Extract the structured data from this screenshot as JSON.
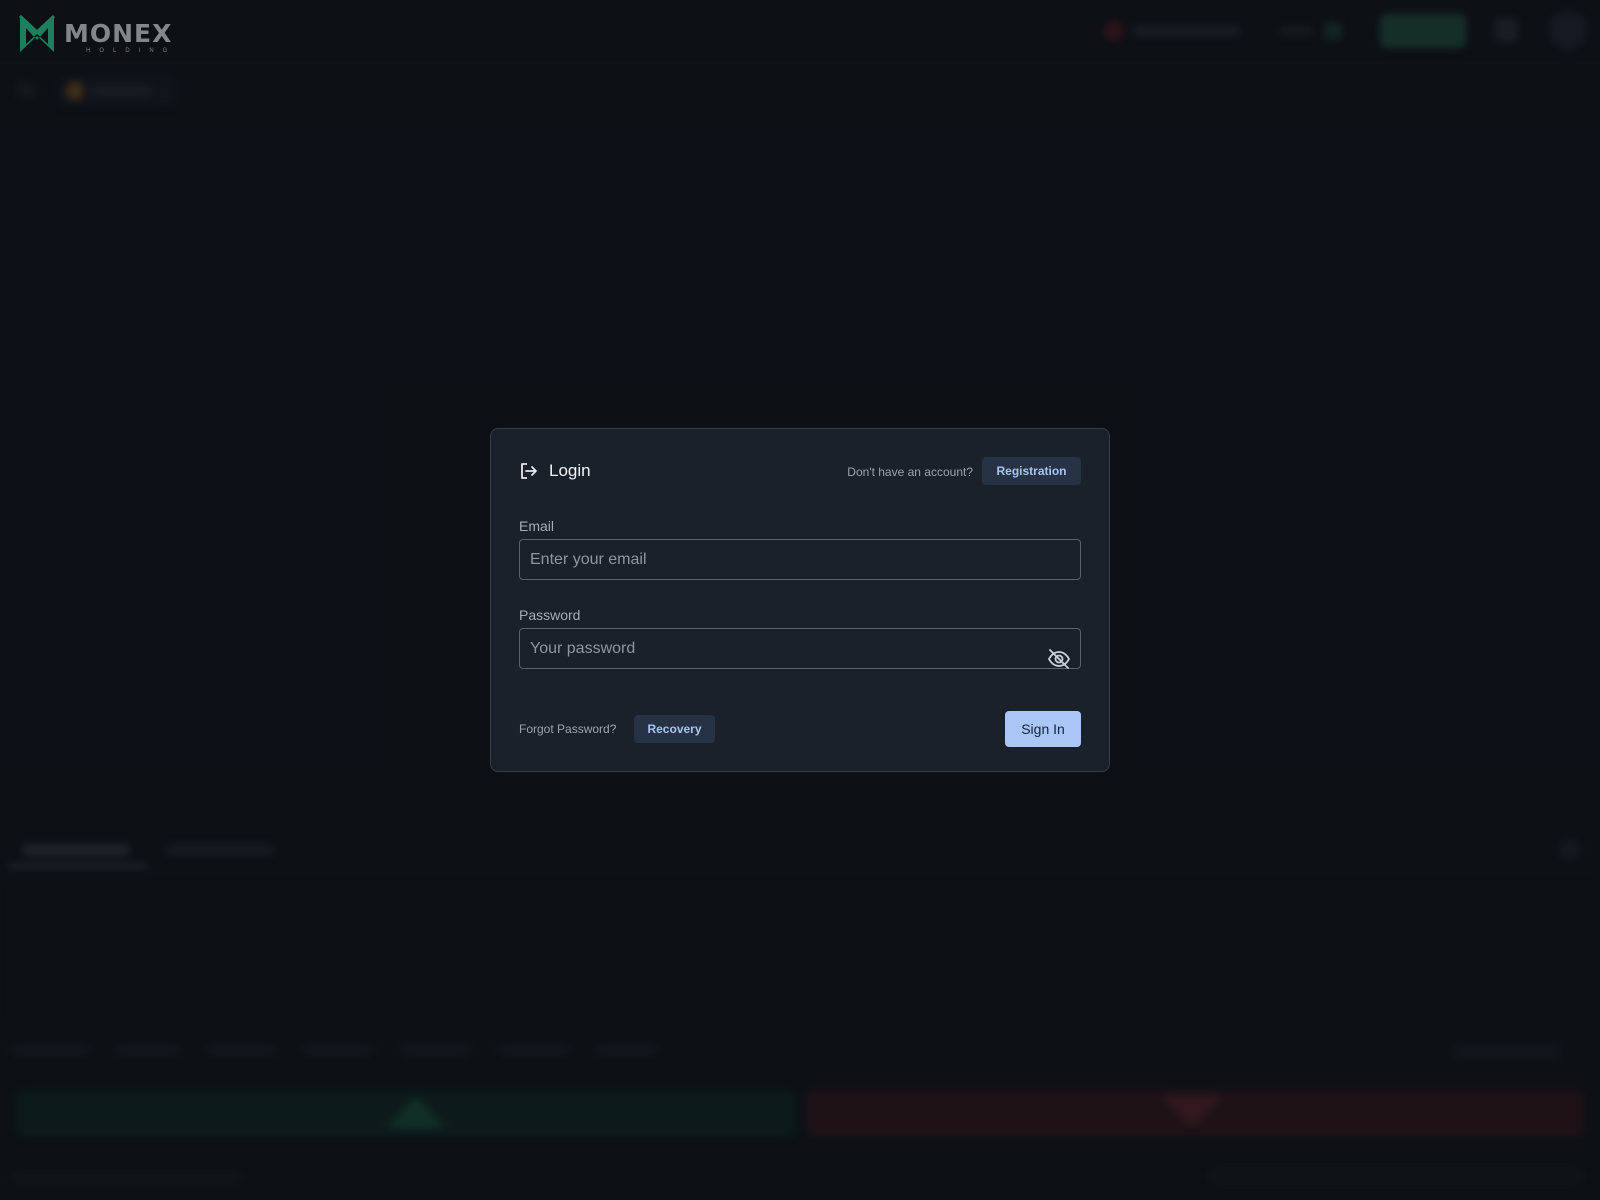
{
  "brand": {
    "name": "MONEX",
    "subtitle": "HOLDING",
    "accent_color": "#2de0a0"
  },
  "login": {
    "title": "Login",
    "no_account_text": "Don't have an account?",
    "registration_label": "Registration",
    "email": {
      "label": "Email",
      "placeholder": "Enter your email",
      "value": ""
    },
    "password": {
      "label": "Password",
      "placeholder": "Your password",
      "value": "",
      "visibility_icon": "eye-off-icon"
    },
    "forgot_text": "Forgot Password?",
    "recovery_label": "Recovery",
    "signin_label": "Sign In"
  },
  "colors": {
    "background": "#11151c",
    "modal_bg": "#1b212b",
    "primary_button": "#a9c6f6",
    "secondary_button_bg": "#273244",
    "secondary_button_text": "#a8c4f4",
    "buy": "#0f3a2a",
    "sell": "#4a1d24"
  }
}
